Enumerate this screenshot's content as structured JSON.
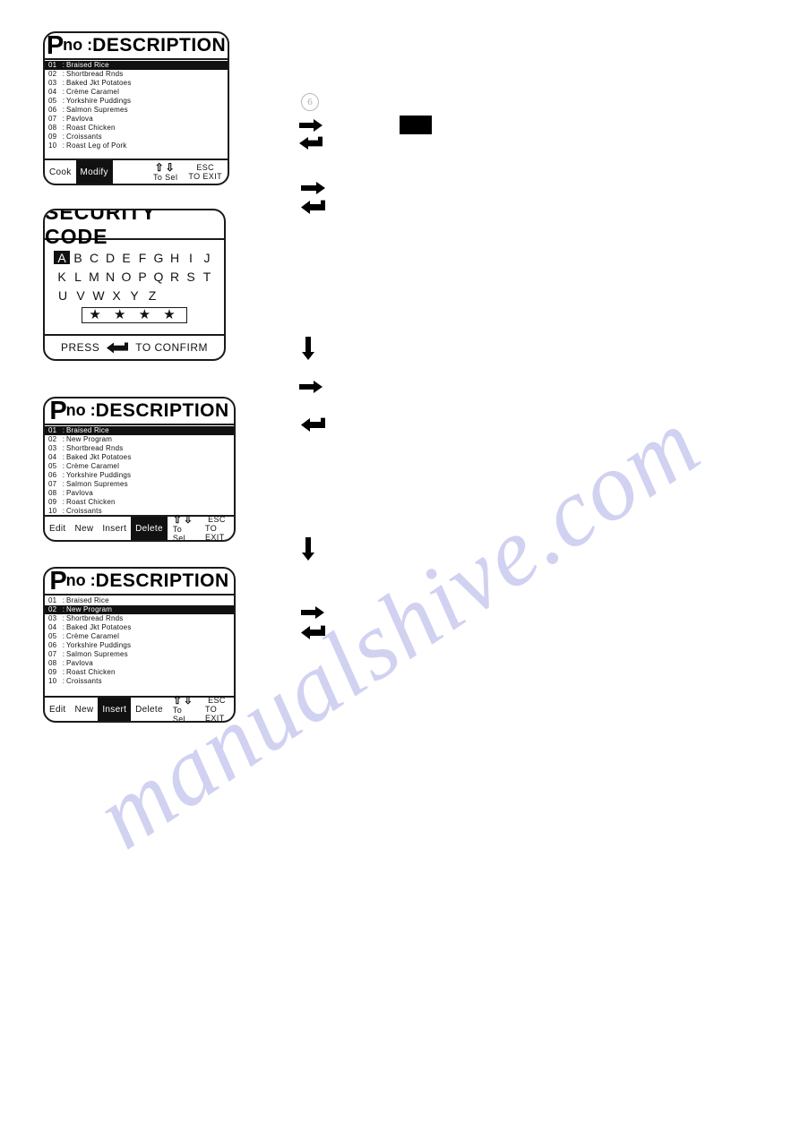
{
  "watermark": {
    "text": "manualshive.com",
    "color": "#c9c9ef"
  },
  "panels": {
    "programme_list_1": {
      "header": {
        "p": "P",
        "no": "no :",
        "description": "DESCRIPTION"
      },
      "rows": [
        {
          "num": "01",
          "sep": ":",
          "name": "Braised Rice",
          "selected": true
        },
        {
          "num": "02",
          "sep": ":",
          "name": "Shortbread Rnds",
          "selected": false
        },
        {
          "num": "03",
          "sep": ":",
          "name": "Baked Jkt Potatoes",
          "selected": false
        },
        {
          "num": "04",
          "sep": ":",
          "name": "Crème Caramel",
          "selected": false
        },
        {
          "num": "05",
          "sep": ":",
          "name": "Yorkshire Puddings",
          "selected": false
        },
        {
          "num": "06",
          "sep": ":",
          "name": "Salmon Supremes",
          "selected": false
        },
        {
          "num": "07",
          "sep": ":",
          "name": "Pavlova",
          "selected": false
        },
        {
          "num": "08",
          "sep": ":",
          "name": "Roast Chicken",
          "selected": false
        },
        {
          "num": "09",
          "sep": ":",
          "name": "Croissants",
          "selected": false
        },
        {
          "num": "10",
          "sep": ":",
          "name": "Roast Leg of Pork",
          "selected": false
        }
      ],
      "keys": [
        {
          "label": "Cook",
          "active": false
        },
        {
          "label": "Modify",
          "active": true
        }
      ],
      "hint_select": {
        "line1": "To Sel"
      },
      "hint_exit": {
        "line1": "ESC",
        "line2": "TO EXIT"
      }
    },
    "security_code": {
      "title": "SECURITY CODE",
      "alphabet_rows": [
        [
          "A",
          "B",
          "C",
          "D",
          "E",
          "F",
          "G",
          "H",
          "I",
          "J"
        ],
        [
          "K",
          "L",
          "M",
          "N",
          "O",
          "P",
          "Q",
          "R",
          "S",
          "T"
        ],
        [
          "U",
          "V",
          "W",
          "X",
          "Y",
          "Z"
        ]
      ],
      "selected_letter": "A",
      "code_value": "★ ★ ★ ★",
      "footer_before": "PRESS",
      "footer_after": "TO CONFIRM"
    },
    "programme_list_2": {
      "header": {
        "p": "P",
        "no": "no :",
        "description": "DESCRIPTION"
      },
      "rows": [
        {
          "num": "01",
          "sep": ":",
          "name": "Braised Rice",
          "selected": true
        },
        {
          "num": "02",
          "sep": ":",
          "name": "New Program",
          "selected": false
        },
        {
          "num": "03",
          "sep": ":",
          "name": "Shortbread Rnds",
          "selected": false
        },
        {
          "num": "04",
          "sep": ":",
          "name": "Baked Jkt Potatoes",
          "selected": false
        },
        {
          "num": "05",
          "sep": ":",
          "name": "Crème Caramel",
          "selected": false
        },
        {
          "num": "06",
          "sep": ":",
          "name": "Yorkshire Puddings",
          "selected": false
        },
        {
          "num": "07",
          "sep": ":",
          "name": "Salmon Supremes",
          "selected": false
        },
        {
          "num": "08",
          "sep": ":",
          "name": "Pavlova",
          "selected": false
        },
        {
          "num": "09",
          "sep": ":",
          "name": "Roast Chicken",
          "selected": false
        },
        {
          "num": "10",
          "sep": ":",
          "name": "Croissants",
          "selected": false
        }
      ],
      "keys": [
        {
          "label": "Edit",
          "active": false
        },
        {
          "label": "New",
          "active": false
        },
        {
          "label": "Insert",
          "active": false
        },
        {
          "label": "Delete",
          "active": true
        }
      ],
      "hint_select": {
        "line1": "To Sel"
      },
      "hint_exit": {
        "line1": "ESC",
        "line2": "TO EXIT"
      }
    },
    "programme_list_3": {
      "header": {
        "p": "P",
        "no": "no :",
        "description": "DESCRIPTION"
      },
      "rows": [
        {
          "num": "01",
          "sep": ":",
          "name": "Braised Rice",
          "selected": false
        },
        {
          "num": "02",
          "sep": ":",
          "name": "New Program",
          "selected": true
        },
        {
          "num": "03",
          "sep": ":",
          "name": "Shortbread Rnds",
          "selected": false
        },
        {
          "num": "04",
          "sep": ":",
          "name": "Baked Jkt Potatoes",
          "selected": false
        },
        {
          "num": "05",
          "sep": ":",
          "name": "Crème Caramel",
          "selected": false
        },
        {
          "num": "06",
          "sep": ":",
          "name": "Yorkshire Puddings",
          "selected": false
        },
        {
          "num": "07",
          "sep": ":",
          "name": "Salmon Supremes",
          "selected": false
        },
        {
          "num": "08",
          "sep": ":",
          "name": "Pavlova",
          "selected": false
        },
        {
          "num": "09",
          "sep": ":",
          "name": "Roast Chicken",
          "selected": false
        },
        {
          "num": "10",
          "sep": ":",
          "name": "Croissants",
          "selected": false
        }
      ],
      "keys": [
        {
          "label": "Edit",
          "active": false
        },
        {
          "label": "New",
          "active": false
        },
        {
          "label": "Insert",
          "active": true
        },
        {
          "label": "Delete",
          "active": false
        }
      ],
      "hint_select": {
        "line1": "To Sel"
      },
      "hint_exit": {
        "line1": "ESC",
        "line2": "TO EXIT"
      }
    }
  },
  "flow_glyphs": [
    {
      "name": "circle-mark",
      "symbol": "6"
    },
    {
      "name": "arrow-right-icon-1"
    },
    {
      "name": "arrow-enter-icon-1"
    },
    {
      "name": "arrow-right-icon-2"
    },
    {
      "name": "arrow-enter-icon-2"
    },
    {
      "name": "arrow-down-icon-1"
    },
    {
      "name": "arrow-right-icon-3"
    },
    {
      "name": "arrow-enter-icon-3"
    },
    {
      "name": "arrow-down-icon-2"
    },
    {
      "name": "arrow-right-icon-4"
    },
    {
      "name": "arrow-enter-icon-4"
    }
  ],
  "redaction_block": {
    "name": "black-redaction-block"
  }
}
